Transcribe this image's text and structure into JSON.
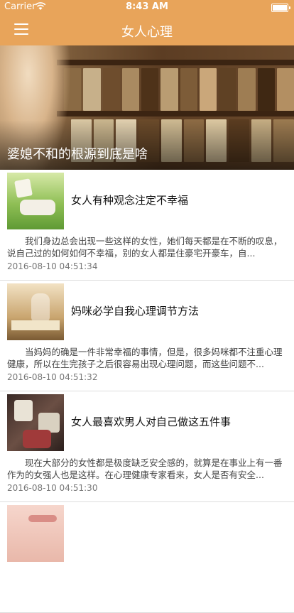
{
  "status_bar": {
    "carrier": "Carrier",
    "time": "8:43 AM"
  },
  "nav": {
    "title": "女人心理"
  },
  "hero": {
    "title": "婆媳不和的根源到底是啥"
  },
  "articles": [
    {
      "title": "女人有种观念注定不幸福",
      "summary": "我们身边总会出现一些这样的女性，她们每天都是在不断的叹息，说自己过的如何如何不幸福，别的女人都是住豪宅开豪车，自...",
      "date": "2016-08-10 04:51:34"
    },
    {
      "title": "妈咪必学自我心理调节方法",
      "summary": "当妈妈的确是一件非常幸福的事情，但是，很多妈咪都不注重心理健康，所以在生完孩子之后很容易出现心理问题，而这些问题不...",
      "date": "2016-08-10 04:51:32"
    },
    {
      "title": "女人最喜欢男人对自己做这五件事",
      "summary": "现在大部分的女性都是极度缺乏安全感的，就算是在事业上有一番作为的女强人也是这样。在心理健康专家看来，女人是否有安全...",
      "date": "2016-08-10 04:51:30"
    },
    {
      "title": "",
      "summary": "",
      "date": ""
    }
  ],
  "colors": {
    "nav_bg": "#e8a45a",
    "text_dark": "#111111",
    "text_muted": "#777777"
  },
  "icons": [
    "wifi-icon",
    "battery-icon",
    "menu-icon"
  ]
}
